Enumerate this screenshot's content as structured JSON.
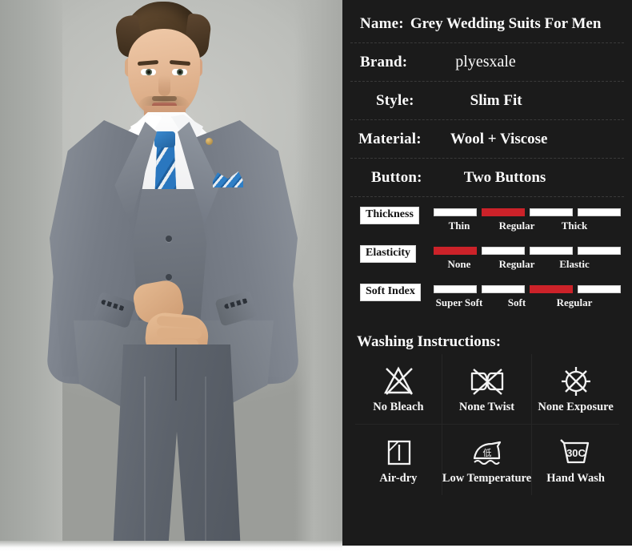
{
  "product_photo": {
    "alt": "Man wearing grey three-piece slim fit wedding suit with blue striped tie and pocket square"
  },
  "specs": [
    {
      "label": "Name:",
      "value": "Grey Wedding Suits For Men"
    },
    {
      "label": "Brand:",
      "value": "plyesxale"
    },
    {
      "label": "Style:",
      "value": "Slim  Fit"
    },
    {
      "label": "Material:",
      "value": "Wool  + Viscose"
    },
    {
      "label": "Button:",
      "value": "Two  Buttons"
    }
  ],
  "ratings": [
    {
      "name": "Thickness",
      "levels": [
        "Thin",
        "Regular",
        "Thick"
      ],
      "bar_count": 4,
      "selected_index": 1
    },
    {
      "name": "Elasticity",
      "levels": [
        "None",
        "Regular",
        "Elastic"
      ],
      "bar_count": 4,
      "selected_index": 0
    },
    {
      "name": "Soft Index",
      "levels": [
        "Super Soft",
        "Soft",
        "Regular"
      ],
      "bar_count": 4,
      "selected_index": 2
    }
  ],
  "washing": {
    "title": "Washing Instructions:",
    "items": [
      {
        "icon": "no-bleach-icon",
        "label": "No Bleach"
      },
      {
        "icon": "no-twist-icon",
        "label": "None Twist"
      },
      {
        "icon": "no-sun-exposure-icon",
        "label": "None Exposure"
      },
      {
        "icon": "air-dry-icon",
        "label": "Air-dry"
      },
      {
        "icon": "low-temperature-iron-icon",
        "label": "Low Temperature",
        "iron_mark": "低"
      },
      {
        "icon": "hand-wash-icon",
        "label": "Hand Wash",
        "tub_mark": "30C"
      }
    ]
  },
  "colors": {
    "panel_background": "#1b1b1b",
    "text": "#f2f2f2",
    "bar_empty": "#ffffff",
    "bar_active": "#cc2229",
    "badge_background": "#ffffff",
    "badge_text": "#111111",
    "photo_background": "#b9bbb7",
    "suit_grey": "#6a707a",
    "tie_blue": "#2f7fc6"
  }
}
